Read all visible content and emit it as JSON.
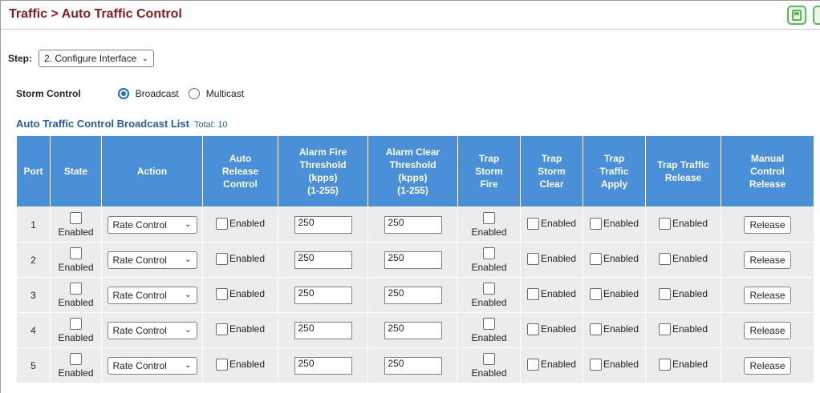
{
  "header": {
    "title": "Traffic > Auto Traffic Control",
    "save_icon": "save-icon"
  },
  "step": {
    "label": "Step:",
    "selected": "2. Configure Interface"
  },
  "storm_control": {
    "label": "Storm Control",
    "options": [
      {
        "label": "Broadcast",
        "checked": true
      },
      {
        "label": "Multicast",
        "checked": false
      }
    ]
  },
  "list": {
    "title": "Auto Traffic Control Broadcast List",
    "total": "Total: 10"
  },
  "table": {
    "columns": [
      [
        "Port"
      ],
      [
        "State"
      ],
      [
        "Action"
      ],
      [
        "Auto",
        "Release",
        "Control"
      ],
      [
        "Alarm Fire",
        "Threshold",
        "(kpps)",
        "(1-255)"
      ],
      [
        "Alarm Clear",
        "Threshold",
        "(kpps)",
        "(1-255)"
      ],
      [
        "Trap",
        "Storm",
        "Fire"
      ],
      [
        "Trap",
        "Storm",
        "Clear"
      ],
      [
        "Trap",
        "Traffic",
        "Apply"
      ],
      [
        "Trap Traffic",
        "Release"
      ],
      [
        "Manual",
        "Control",
        "Release"
      ]
    ],
    "enabled_label": "Enabled",
    "release_label": "Release",
    "rows": [
      {
        "port": "1",
        "action": "Rate Control",
        "alarm_fire": "250",
        "alarm_clear": "250"
      },
      {
        "port": "2",
        "action": "Rate Control",
        "alarm_fire": "250",
        "alarm_clear": "250"
      },
      {
        "port": "3",
        "action": "Rate Control",
        "alarm_fire": "250",
        "alarm_clear": "250"
      },
      {
        "port": "4",
        "action": "Rate Control",
        "alarm_fire": "250",
        "alarm_clear": "250"
      },
      {
        "port": "5",
        "action": "Rate Control",
        "alarm_fire": "250",
        "alarm_clear": "250"
      }
    ]
  }
}
